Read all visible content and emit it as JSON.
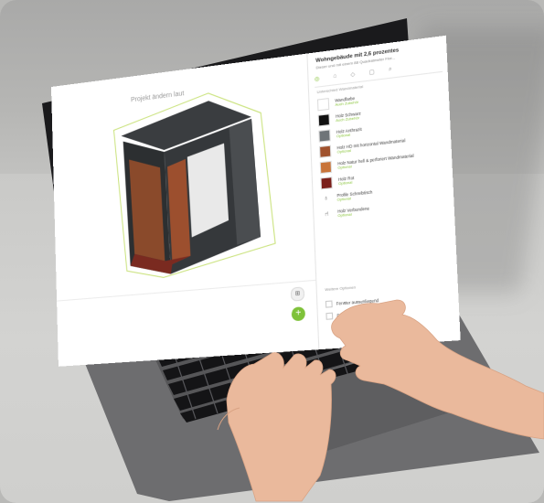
{
  "screen": {
    "viewport_title": "Projekt ändern laut",
    "panel": {
      "title": "Wohngebäude mit 2,6 prozentes",
      "subtitle": "Dieser und mit einem 88 Quadratmeter Flor...",
      "tabs": [
        {
          "label": "◎",
          "active": true
        },
        {
          "label": "⌂",
          "active": false
        },
        {
          "label": "◇",
          "active": false
        },
        {
          "label": "▢",
          "active": false
        },
        {
          "label": "⌕",
          "active": false
        }
      ],
      "section_label": "Unterschied Wandmaterial",
      "materials": [
        {
          "name": "Wandfarbe",
          "price": "Auch Zubehör",
          "color": "#ffffff"
        },
        {
          "name": "Holz Schwarz",
          "price": "Auch Zubehör",
          "color": "#111111"
        },
        {
          "name": "Holz Anthrazit",
          "price": "Optional",
          "color": "#6f7478"
        },
        {
          "name": "Holz HD mit horizontal Wandmaterial",
          "price": "Optional",
          "color": "#a0522d"
        },
        {
          "name": "Holz Natur hell & perforiert Wandmaterial",
          "price": "Optional",
          "color": "#c8743a"
        },
        {
          "name": "Holz Rot",
          "price": "Optional",
          "color": "#7a1f1a"
        },
        {
          "name": "Profile Schreibtisch",
          "price": "Optional",
          "icon": "lamp-icon"
        },
        {
          "name": "Holz Verbundene",
          "price": "Optional",
          "icon": "chair-icon"
        }
      ],
      "section2_label": "Weitere Optionen",
      "options": [
        {
          "label": "Fenster aussenliegend"
        },
        {
          "label": "Fenster innenliegend"
        }
      ],
      "round_button": "⊞",
      "add_button": "+"
    }
  },
  "colors": {
    "accent": "#7fc23a",
    "cabin_frame": "#2c2f31",
    "cabin_wood": "#8a4a2b",
    "desk": "#cfcfcd",
    "wall": "#b3b3b1"
  }
}
